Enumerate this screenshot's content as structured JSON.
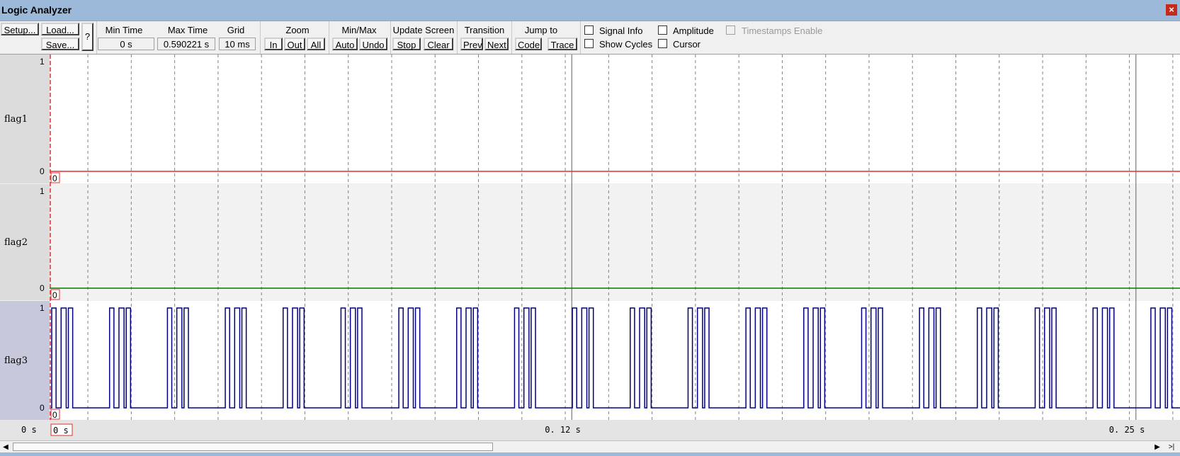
{
  "window": {
    "title": "Logic Analyzer",
    "close_glyph": "×"
  },
  "toolbar": {
    "setup": "Setup...",
    "load": "Load...",
    "save": "Save...",
    "help": "?",
    "min_time_label": "Min Time",
    "min_time_value": "0 s",
    "max_time_label": "Max Time",
    "max_time_value": "0.590221 s",
    "grid_label": "Grid",
    "grid_value": "10 ms",
    "zoom_label": "Zoom",
    "zoom_in": "In",
    "zoom_out": "Out",
    "zoom_all": "All",
    "minmax_label": "Min/Max",
    "minmax_auto": "Auto",
    "minmax_undo": "Undo",
    "update_label": "Update Screen",
    "update_stop": "Stop",
    "update_clear": "Clear",
    "transition_label": "Transition",
    "transition_prev": "Prev",
    "transition_next": "Next",
    "jump_label": "Jump to",
    "jump_code": "Code",
    "jump_trace": "Trace",
    "signal_info": "Signal Info",
    "show_cycles": "Show Cycles",
    "amplitude": "Amplitude",
    "cursor": "Cursor",
    "timestamps": "Timestamps Enable"
  },
  "checkboxes": {
    "signal_info": false,
    "show_cycles": false,
    "amplitude": false,
    "cursor": false,
    "timestamps": false
  },
  "chart_data": {
    "type": "line",
    "x_unit": "s",
    "x_range": [
      0,
      0.2595
    ],
    "grid_ms": 10,
    "cursor_time": 0.12,
    "end_marker_time": 0.25,
    "axis_start_label": "0 s",
    "cursor_label": "0. 12  s",
    "end_label": "0. 25  s",
    "marker_box_label": "0 s",
    "signals": [
      {
        "name": "flag1",
        "high": "1",
        "low": "0",
        "value_box": "0",
        "color": "#e03030",
        "bg": "#ffffff",
        "constant": 0
      },
      {
        "name": "flag2",
        "high": "1",
        "low": "0",
        "value_box": "0",
        "color": "#008000",
        "bg": "#f2f2f2",
        "constant": 0
      },
      {
        "name": "flag3",
        "high": "1",
        "low": "0",
        "value_box": "0",
        "color": "#000080",
        "bg": "#ffffff",
        "pattern_period_ms": 13.33,
        "pattern_on_off_ms": [
          [
            0.17,
            1.17
          ],
          [
            2.33,
            3.5
          ],
          [
            4.0,
            5.0
          ]
        ]
      }
    ]
  },
  "colors": {
    "label_bg": "#dcdcdc",
    "label_bg_selected": "#c8c8dc",
    "gridline": "#808080"
  }
}
